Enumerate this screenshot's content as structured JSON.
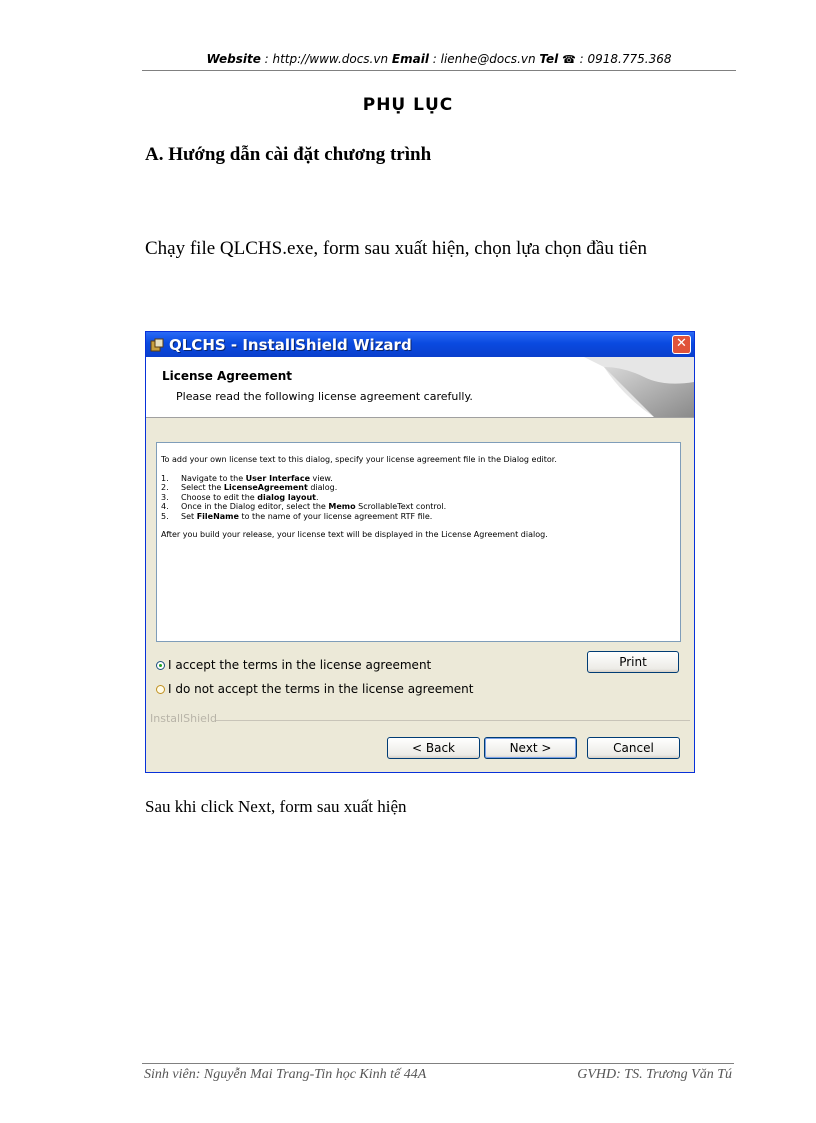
{
  "header": {
    "website_label": "Website",
    "website_value": " : http://www.docs.vn ",
    "email_label": "Email",
    "email_value": " : lienhe@docs.vn ",
    "tel_label": "Tel",
    "phone_icon": "phone-icon",
    "tel_value": " : 0918.775.368"
  },
  "title": "PHỤ LỤC",
  "section_heading": "A. Hướng dẫn cài đặt chương trình",
  "paragraph1": "Chạy file QLCHS.exe,  form sau xuất hiện, chọn lựa chọn đầu tiên",
  "dialog": {
    "title": "QLCHS - InstallShield Wizard",
    "banner_title": "License Agreement",
    "banner_subtitle": "Please read the following license agreement carefully.",
    "license_intro": "To add your own license text to this dialog, specify your license agreement file in the Dialog editor.",
    "steps": [
      {
        "num": "1.",
        "pre": "Navigate to the ",
        "bold": "User Interface",
        "post": " view."
      },
      {
        "num": "2.",
        "pre": "Select the ",
        "bold": "LicenseAgreement",
        "post": " dialog."
      },
      {
        "num": "3.",
        "pre": "Choose to edit the ",
        "bold": "dialog layout",
        "post": "."
      },
      {
        "num": "4.",
        "pre": "Once in the Dialog editor, select the ",
        "bold": "Memo",
        "post": " ScrollableText control."
      },
      {
        "num": "5.",
        "pre": "Set ",
        "bold": "FileName",
        "post": " to the name of your license agreement RTF file."
      }
    ],
    "license_outro": "After you build your release, your license text will be displayed in the License Agreement dialog.",
    "accept_label": "I accept the terms in the license agreement",
    "decline_label": "I do not accept the terms in the license agreement",
    "print_label": "Print",
    "brand_label": "InstallShield",
    "back_label": "< Back",
    "next_label": "Next >",
    "cancel_label": "Cancel",
    "close_icon": "close-icon"
  },
  "paragraph2": "Sau khi click Next, form sau xuất hiện",
  "footer": {
    "left": "Sinh viên: Nguyễn Mai Trang-Tin học Kinh tế 44A",
    "right": "GVHD: TS. Trương Văn Tú"
  }
}
